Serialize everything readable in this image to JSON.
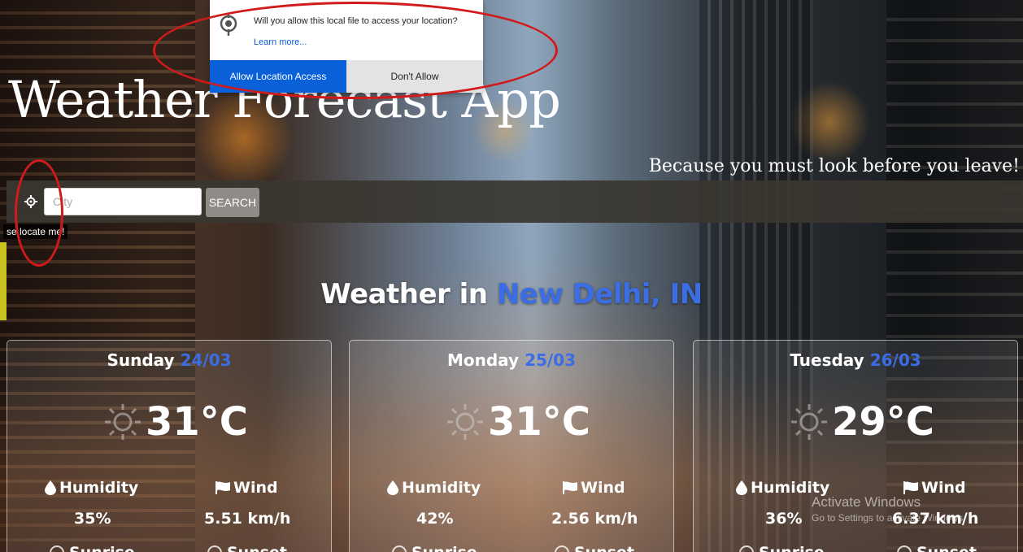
{
  "app": {
    "title": "Weather Forecast App",
    "tagline": "Because you must look before you leave!"
  },
  "search": {
    "placeholder": "City",
    "button_label": "SEARCH",
    "locate_tooltip": "se locate me!"
  },
  "headline": {
    "prefix": "Weather in ",
    "location": "New Delhi, IN"
  },
  "labels": {
    "humidity": "Humidity",
    "wind": "Wind",
    "sunrise": "Sunrise",
    "sunset": "Sunset"
  },
  "forecast": [
    {
      "day": "Sunday",
      "date": "24/03",
      "temp": "31°C",
      "humidity": "35%",
      "wind": "5.51 km/h"
    },
    {
      "day": "Monday",
      "date": "25/03",
      "temp": "31°C",
      "humidity": "42%",
      "wind": "2.56 km/h"
    },
    {
      "day": "Tuesday",
      "date": "26/03",
      "temp": "29°C",
      "humidity": "36%",
      "wind": "6.37 km/h"
    }
  ],
  "permission_popup": {
    "message": "Will you allow this local file to access your location?",
    "learn_more": "Learn more...",
    "allow_label": "Allow Location Access",
    "deny_label": "Don't Allow"
  },
  "watermark": {
    "line1": "Activate Windows",
    "line2": "Go to Settings to activate Windows."
  },
  "colors": {
    "accent_blue": "#3b6de5",
    "popup_allow": "#0a60d8",
    "annotation_red": "#d11b1b",
    "search_bar": "#3a3730"
  }
}
